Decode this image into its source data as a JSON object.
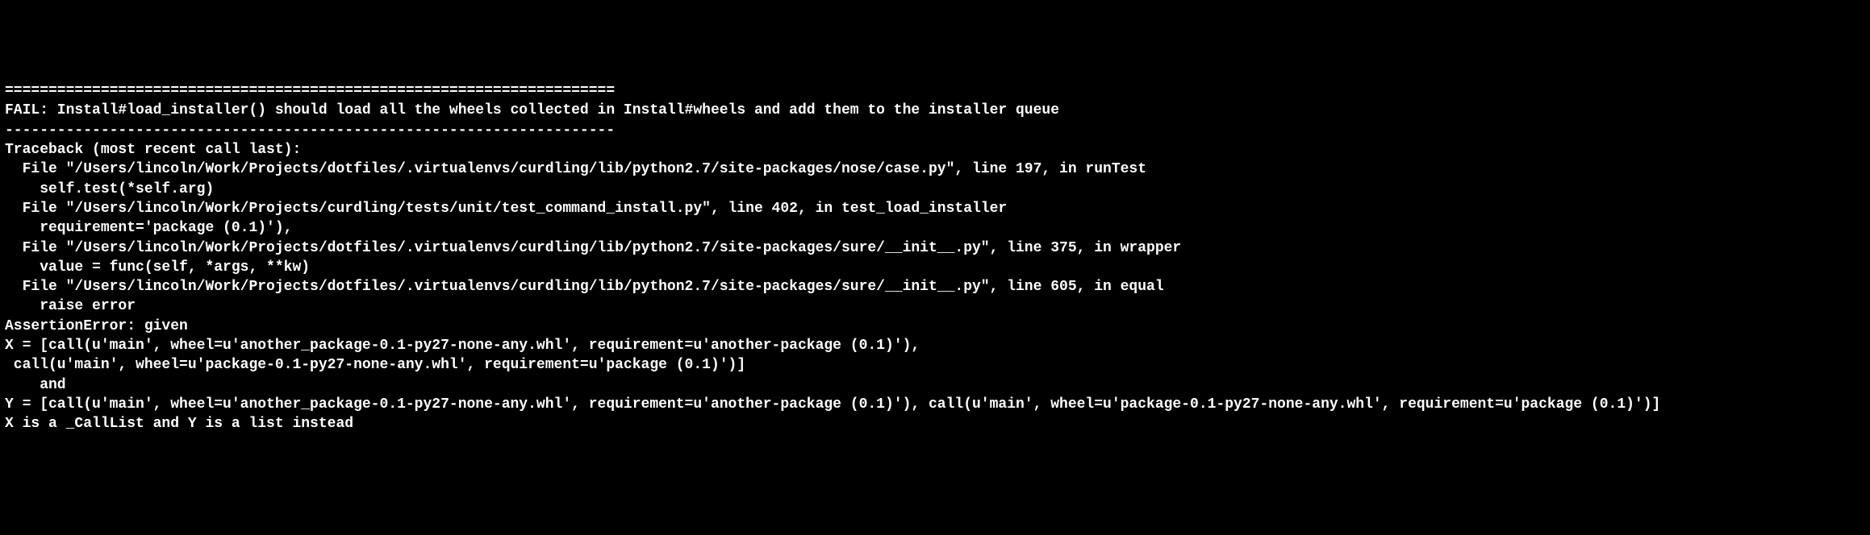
{
  "terminal": {
    "lines": [
      "======================================================================",
      "FAIL: Install#load_installer() should load all the wheels collected in Install#wheels and add them to the installer queue",
      "----------------------------------------------------------------------",
      "Traceback (most recent call last):",
      "  File \"/Users/lincoln/Work/Projects/dotfiles/.virtualenvs/curdling/lib/python2.7/site-packages/nose/case.py\", line 197, in runTest",
      "    self.test(*self.arg)",
      "  File \"/Users/lincoln/Work/Projects/curdling/tests/unit/test_command_install.py\", line 402, in test_load_installer",
      "    requirement='package (0.1)'),",
      "  File \"/Users/lincoln/Work/Projects/dotfiles/.virtualenvs/curdling/lib/python2.7/site-packages/sure/__init__.py\", line 375, in wrapper",
      "    value = func(self, *args, **kw)",
      "  File \"/Users/lincoln/Work/Projects/dotfiles/.virtualenvs/curdling/lib/python2.7/site-packages/sure/__init__.py\", line 605, in equal",
      "    raise error",
      "AssertionError: given",
      "X = [call(u'main', wheel=u'another_package-0.1-py27-none-any.whl', requirement=u'another-package (0.1)'),",
      " call(u'main', wheel=u'package-0.1-py27-none-any.whl', requirement=u'package (0.1)')]",
      "    and",
      "Y = [call(u'main', wheel=u'another_package-0.1-py27-none-any.whl', requirement=u'another-package (0.1)'), call(u'main', wheel=u'package-0.1-py27-none-any.whl', requirement=u'package (0.1)')]",
      "X is a _CallList and Y is a list instead"
    ]
  }
}
